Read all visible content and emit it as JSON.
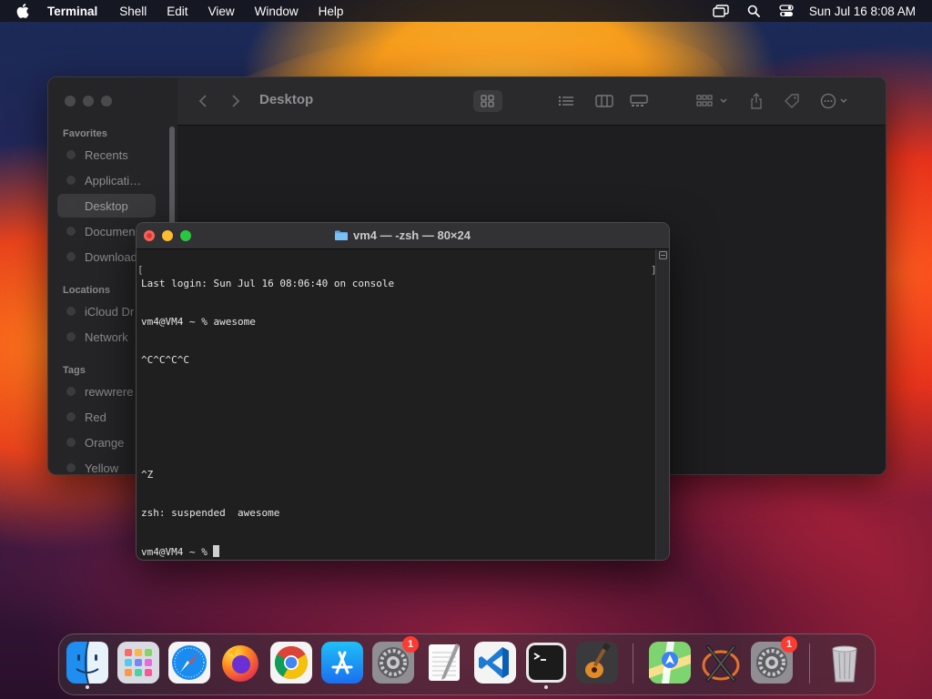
{
  "menubar": {
    "app_name": "Terminal",
    "menus": [
      "Shell",
      "Edit",
      "View",
      "Window",
      "Help"
    ],
    "clock": "Sun Jul 16  8:08 AM",
    "status_icons": [
      "screen-mirroring-icon",
      "spotlight-search-icon",
      "control-center-icon"
    ]
  },
  "finder": {
    "title": "Desktop",
    "sidebar": {
      "favorites_label": "Favorites",
      "favorites": [
        "Recents",
        "Applicati…",
        "Desktop",
        "Documen",
        "Download"
      ],
      "selected": "Desktop",
      "locations_label": "Locations",
      "locations": [
        "iCloud Dr",
        "Network"
      ],
      "tags_label": "Tags",
      "tags": [
        "rewwrere",
        "Red",
        "Orange",
        "Yellow"
      ]
    }
  },
  "terminal": {
    "title": "vm4 — -zsh — 80×24",
    "lines": [
      "Last login: Sun Jul 16 08:06:40 on console",
      "vm4@VM4 ~ % awesome",
      "^C^C^C^C",
      "",
      "",
      "^Z",
      "zsh: suspended  awesome",
      "vm4@VM4 ~ % "
    ]
  },
  "dock": {
    "apps": [
      {
        "name": "Finder",
        "running": true
      },
      {
        "name": "Launchpad"
      },
      {
        "name": "Safari"
      },
      {
        "name": "Firefox"
      },
      {
        "name": "Google Chrome"
      },
      {
        "name": "App Store"
      },
      {
        "name": "System Settings",
        "badge": "1"
      },
      {
        "name": "TextEdit"
      },
      {
        "name": "Visual Studio Code"
      },
      {
        "name": "Terminal",
        "running": true
      },
      {
        "name": "GarageBand"
      },
      {
        "name": "Maps"
      },
      {
        "name": "X11"
      },
      {
        "name": "System Preferences",
        "badge": "1"
      },
      {
        "name": "Trash"
      }
    ]
  }
}
